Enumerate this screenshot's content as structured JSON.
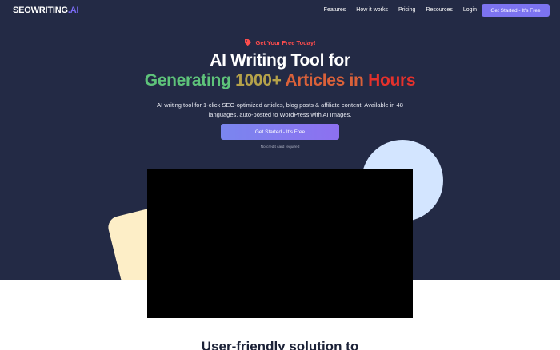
{
  "nav": {
    "logo": {
      "main": "SEOWRITING",
      "accent": ".AI"
    },
    "links": [
      "Features",
      "How it works",
      "Pricing",
      "Resources",
      "Login"
    ],
    "cta_label": "Get Started - It's Free"
  },
  "hero": {
    "badge": "Get Your Free Today!",
    "title_line1": "AI Writing Tool for",
    "title_line2": {
      "part1": "Generating",
      "part2": "1000+",
      "part3": "Articles in",
      "part4": "Hours"
    },
    "subtitle": "AI writing tool for 1-click SEO-optimized articles, blog posts & affiliate content. Available in 48 languages, auto-posted to WordPress with AI Images.",
    "cta_label": "Get Started - It's Free",
    "note": "No credit card required"
  },
  "section": {
    "title": "User-friendly solution to"
  },
  "colors": {
    "hero_bg": "#232a45",
    "accent": "#7c73f0",
    "badge_red": "#ff4d4d",
    "circle": "#d3e5ff",
    "square": "#fdeec7"
  },
  "icons": {
    "badge": "tag-icon"
  }
}
